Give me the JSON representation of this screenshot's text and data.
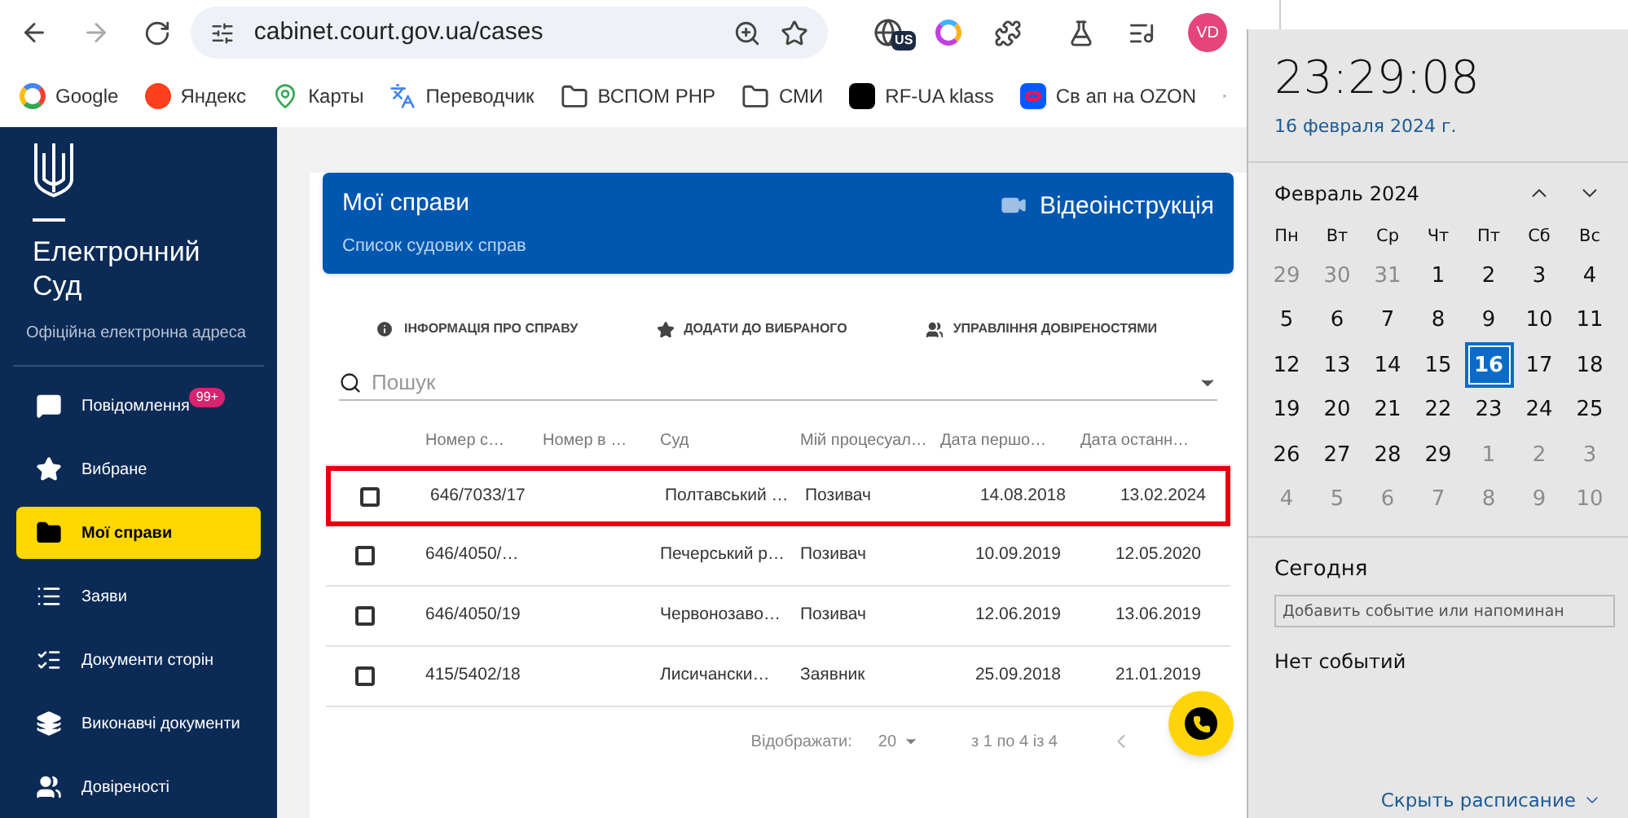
{
  "browser": {
    "url": "cabinet.court.gov.ua/cases",
    "profile_initials": "VD",
    "extension_badge": "US",
    "bookmarks": [
      {
        "label": "Google",
        "kind": "google"
      },
      {
        "label": "Яндекс",
        "kind": "yandex"
      },
      {
        "label": "Карты",
        "kind": "maps"
      },
      {
        "label": "Переводчик",
        "kind": "translate"
      },
      {
        "label": "ВСПОМ PHP",
        "kind": "folder"
      },
      {
        "label": "СМИ",
        "kind": "folder"
      },
      {
        "label": "RF-UA klass",
        "kind": "app"
      },
      {
        "label": "Св ап на OZON",
        "kind": "ozon"
      }
    ]
  },
  "sidebar": {
    "title": "Електронний Суд",
    "subtitle": "Офіційна електронна адреса",
    "items": [
      {
        "label": "Повідомлення",
        "badge": "99+",
        "selected": false
      },
      {
        "label": "Вибране",
        "selected": false
      },
      {
        "label": "Мої справи",
        "selected": true
      },
      {
        "label": "Заяви",
        "selected": false
      },
      {
        "label": "Документи сторін",
        "selected": false
      },
      {
        "label": "Виконавчі документи",
        "selected": false
      },
      {
        "label": "Довіреності",
        "selected": false
      }
    ]
  },
  "page_header": {
    "title": "Мої справи",
    "subtitle": "Список судових справ",
    "video_link": "Відеоінструкція"
  },
  "actions": [
    {
      "label": "ІНФОРМАЦІЯ ПРО СПРАВУ"
    },
    {
      "label": "ДОДАТИ ДО ВИБРАНОГО"
    },
    {
      "label": "УПРАВЛІННЯ ДОВІРЕНОСТЯМИ"
    }
  ],
  "search": {
    "placeholder": "Пошук"
  },
  "table": {
    "columns": [
      "Номер с…",
      "Номер в …",
      "Суд",
      "Мій процесуал…",
      "Дата першо…",
      "Дата останн…"
    ],
    "rows": [
      {
        "checked": false,
        "outlined": true,
        "cells": [
          "646/7033/17",
          "",
          "Полтавський …",
          "Позивач",
          "14.08.2018",
          "13.02.2024"
        ]
      },
      {
        "checked": false,
        "outlined": false,
        "cells": [
          "646/4050/…",
          "",
          "Печерський р…",
          "Позивач",
          "10.09.2019",
          "12.05.2020"
        ]
      },
      {
        "checked": false,
        "outlined": false,
        "cells": [
          "646/4050/19",
          "",
          "Червонозаво…",
          "Позивач",
          "12.06.2019",
          "13.06.2019"
        ]
      },
      {
        "checked": false,
        "outlined": false,
        "cells": [
          "415/5402/18",
          "",
          "Лисичански…",
          "Заявник",
          "25.09.2018",
          "21.01.2019"
        ]
      }
    ]
  },
  "pagination": {
    "rows_label": "Відображати:",
    "rows_per_page": "20",
    "range": "з 1 по 4 із 4"
  },
  "calendar": {
    "time": "23:29:08",
    "date": "16 февраля 2024 г.",
    "month": "Февраль 2024",
    "weekdays": [
      "Пн",
      "Вт",
      "Ср",
      "Чт",
      "Пт",
      "Сб",
      "Вс"
    ],
    "days": [
      {
        "label": "29",
        "other_month": true,
        "selected": false
      },
      {
        "label": "30",
        "other_month": true,
        "selected": false
      },
      {
        "label": "31",
        "other_month": true,
        "selected": false
      },
      {
        "label": "1",
        "other_month": false,
        "selected": false
      },
      {
        "label": "2",
        "other_month": false,
        "selected": false
      },
      {
        "label": "3",
        "other_month": false,
        "selected": false
      },
      {
        "label": "4",
        "other_month": false,
        "selected": false
      },
      {
        "label": "5",
        "other_month": false,
        "selected": false
      },
      {
        "label": "6",
        "other_month": false,
        "selected": false
      },
      {
        "label": "7",
        "other_month": false,
        "selected": false
      },
      {
        "label": "8",
        "other_month": false,
        "selected": false
      },
      {
        "label": "9",
        "other_month": false,
        "selected": false
      },
      {
        "label": "10",
        "other_month": false,
        "selected": false
      },
      {
        "label": "11",
        "other_month": false,
        "selected": false
      },
      {
        "label": "12",
        "other_month": false,
        "selected": false
      },
      {
        "label": "13",
        "other_month": false,
        "selected": false
      },
      {
        "label": "14",
        "other_month": false,
        "selected": false
      },
      {
        "label": "15",
        "other_month": false,
        "selected": false
      },
      {
        "label": "16",
        "other_month": false,
        "selected": true
      },
      {
        "label": "17",
        "other_month": false,
        "selected": false
      },
      {
        "label": "18",
        "other_month": false,
        "selected": false
      },
      {
        "label": "19",
        "other_month": false,
        "selected": false
      },
      {
        "label": "20",
        "other_month": false,
        "selected": false
      },
      {
        "label": "21",
        "other_month": false,
        "selected": false
      },
      {
        "label": "22",
        "other_month": false,
        "selected": false
      },
      {
        "label": "23",
        "other_month": false,
        "selected": false
      },
      {
        "label": "24",
        "other_month": false,
        "selected": false
      },
      {
        "label": "25",
        "other_month": false,
        "selected": false
      },
      {
        "label": "26",
        "other_month": false,
        "selected": false
      },
      {
        "label": "27",
        "other_month": false,
        "selected": false
      },
      {
        "label": "28",
        "other_month": false,
        "selected": false
      },
      {
        "label": "29",
        "other_month": false,
        "selected": false
      },
      {
        "label": "1",
        "other_month": true,
        "selected": false
      },
      {
        "label": "2",
        "other_month": true,
        "selected": false
      },
      {
        "label": "3",
        "other_month": true,
        "selected": false
      },
      {
        "label": "4",
        "other_month": true,
        "selected": false
      },
      {
        "label": "5",
        "other_month": true,
        "selected": false
      },
      {
        "label": "6",
        "other_month": true,
        "selected": false
      },
      {
        "label": "7",
        "other_month": true,
        "selected": false
      },
      {
        "label": "8",
        "other_month": true,
        "selected": false
      },
      {
        "label": "9",
        "other_month": true,
        "selected": false
      },
      {
        "label": "10",
        "other_month": true,
        "selected": false
      }
    ],
    "today_heading": "Сегодня",
    "event_placeholder": "Добавить событие или напоминан",
    "no_events": "Нет событий",
    "hide_link": "Скрыть расписание"
  }
}
